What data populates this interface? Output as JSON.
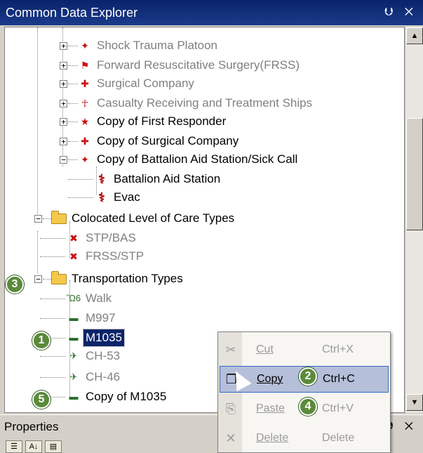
{
  "explorer": {
    "title": "Common Data Explorer",
    "pin_glyph": "⮋",
    "close_glyph": "✕"
  },
  "tree": {
    "nodes": [
      {
        "label": "Shock Trauma Platoon",
        "expander": "+",
        "state": "grey",
        "icon": "shock-trauma-icon",
        "glyph": "✦"
      },
      {
        "label": "Forward Resuscitative Surgery(FRSS)",
        "expander": "+",
        "state": "grey",
        "icon": "frss-icon",
        "glyph": "⚑"
      },
      {
        "label": "Surgical Company",
        "expander": "+",
        "state": "grey",
        "icon": "surgical-company-icon",
        "glyph": "✚"
      },
      {
        "label": "Casualty Receiving and Treatment Ships",
        "expander": "+",
        "state": "grey",
        "icon": "ship-icon",
        "glyph": "☥"
      },
      {
        "label": "Copy of First Responder",
        "expander": "+",
        "state": "normal",
        "icon": "first-responder-icon",
        "glyph": "★"
      },
      {
        "label": "Copy of Surgical Company",
        "expander": "+",
        "state": "normal",
        "icon": "surgical-company-icon",
        "glyph": "✚"
      },
      {
        "label": "Copy of Battalion Aid Station/Sick Call",
        "expander": "−",
        "state": "normal",
        "icon": "aid-station-icon",
        "glyph": "✦"
      },
      {
        "label": "Battalion Aid Station",
        "expander": "",
        "state": "normal",
        "icon": "caduceus-icon",
        "glyph": "⚕"
      },
      {
        "label": "Evac",
        "expander": "",
        "state": "normal",
        "icon": "caduceus-icon",
        "glyph": "⚕"
      },
      {
        "label": "Colocated Level of Care Types",
        "expander": "−",
        "state": "normal",
        "icon": "folder-icon",
        "glyph": ""
      },
      {
        "label": "STP/BAS",
        "expander": "",
        "state": "grey",
        "icon": "stp-bas-icon",
        "glyph": "✖"
      },
      {
        "label": "FRSS/STP",
        "expander": "",
        "state": "grey",
        "icon": "frss-stp-icon",
        "glyph": "✖"
      },
      {
        "label": "Transportation Types",
        "expander": "−",
        "state": "normal",
        "icon": "folder-icon",
        "glyph": ""
      },
      {
        "label": "Walk",
        "expander": "",
        "state": "grey",
        "icon": "walk-icon",
        "glyph": "Ὣ6"
      },
      {
        "label": "M997",
        "expander": "",
        "state": "grey",
        "icon": "ambulance-icon",
        "glyph": "▬"
      },
      {
        "label": "M1035",
        "expander": "",
        "state": "selected",
        "icon": "vehicle-icon",
        "glyph": "▬"
      },
      {
        "label": "CH-53",
        "expander": "",
        "state": "grey",
        "icon": "helicopter-icon",
        "glyph": "✈"
      },
      {
        "label": "CH-46",
        "expander": "",
        "state": "grey",
        "icon": "helicopter-icon",
        "glyph": "✈"
      },
      {
        "label": "Copy of M1035",
        "expander": "",
        "state": "normal",
        "icon": "vehicle-icon",
        "glyph": "▬"
      }
    ]
  },
  "properties": {
    "title": "Properties",
    "pin_glyph": "⮋",
    "close_glyph": "✕",
    "toolbar": [
      "☰",
      "A↓",
      "▤"
    ]
  },
  "context_menu": {
    "items": [
      {
        "label": "Cut",
        "shortcut": "Ctrl+X",
        "icon": "scissors-icon",
        "glyph": "✂",
        "state": "disabled"
      },
      {
        "label": "Copy",
        "shortcut": "Ctrl+C",
        "icon": "copy-icon",
        "glyph": "❐",
        "state": "highlight"
      },
      {
        "label": "Paste",
        "shortcut": "Ctrl+V",
        "icon": "paste-icon",
        "glyph": "⎘",
        "state": "disabled"
      },
      {
        "label": "Delete",
        "shortcut": "Delete",
        "icon": "delete-icon",
        "glyph": "✕",
        "state": "disabled"
      }
    ]
  },
  "callouts": [
    "1",
    "2",
    "3",
    "4",
    "5"
  ],
  "colors": {
    "title_bar": "#0a246a",
    "selection": "#0a246a",
    "menu_highlight": "#b5bfd9",
    "callout": "#5a8a3a"
  }
}
